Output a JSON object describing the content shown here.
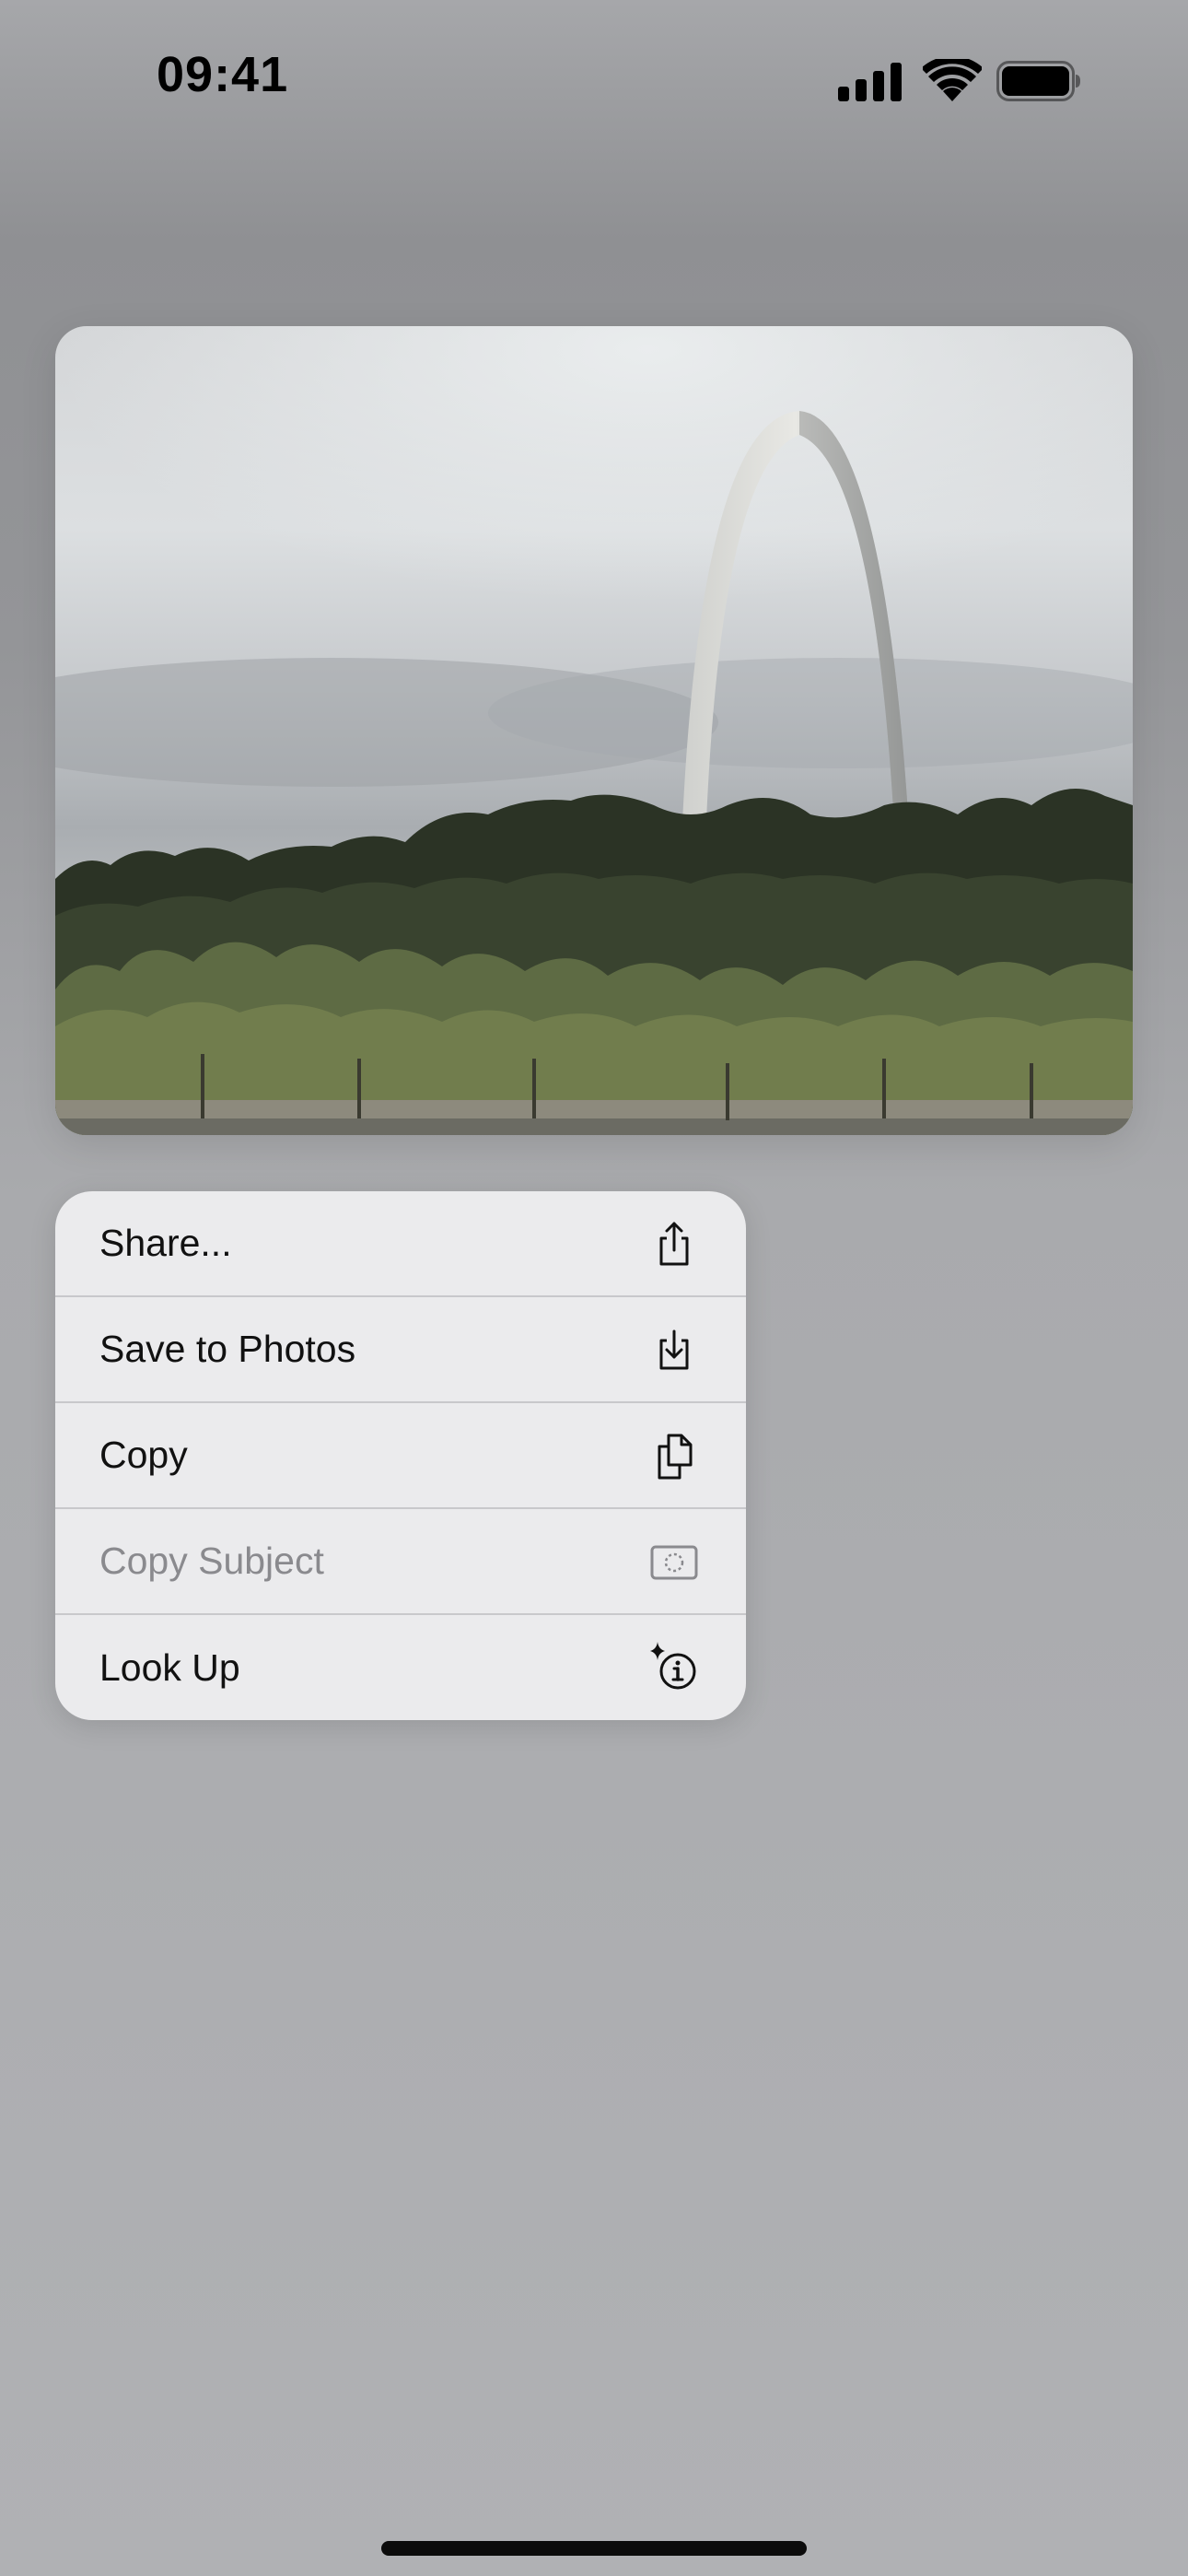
{
  "status_bar": {
    "time": "09:41",
    "icons": [
      "signal-icon",
      "wifi-icon",
      "battery-icon"
    ]
  },
  "photo": {
    "subject": "gateway-arch-photo"
  },
  "menu": {
    "items": [
      {
        "label": "Share...",
        "icon": "share-icon",
        "enabled": true
      },
      {
        "label": "Save to Photos",
        "icon": "save-to-photos-icon",
        "enabled": true
      },
      {
        "label": "Copy",
        "icon": "copy-icon",
        "enabled": true
      },
      {
        "label": "Copy Subject",
        "icon": "copy-subject-icon",
        "enabled": false
      },
      {
        "label": "Look Up",
        "icon": "look-up-icon",
        "enabled": true
      }
    ]
  },
  "colors": {
    "menu_background": "#ebebed",
    "menu_separator": "#c8c8cb",
    "text_primary": "#111111",
    "text_disabled": "#8a8a8e"
  }
}
